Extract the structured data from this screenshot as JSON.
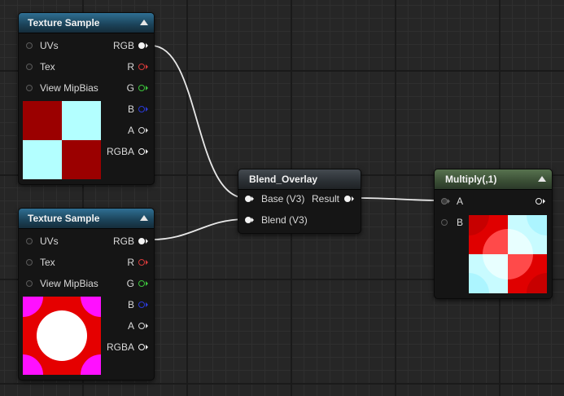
{
  "nodes": {
    "texture_top": {
      "title": "Texture Sample",
      "inputs": [
        "UVs",
        "Tex",
        "View MipBias"
      ],
      "outputs": [
        "RGB",
        "R",
        "G",
        "B",
        "A",
        "RGBA"
      ]
    },
    "texture_bottom": {
      "title": "Texture Sample",
      "inputs": [
        "UVs",
        "Tex",
        "View MipBias"
      ],
      "outputs": [
        "RGB",
        "R",
        "G",
        "B",
        "A",
        "RGBA"
      ]
    },
    "blend": {
      "title": "Blend_Overlay",
      "inputs": [
        "Base (V3)",
        "Blend (V3)"
      ],
      "output": "Result"
    },
    "multiply": {
      "title": "Multiply(,1)",
      "inputs": [
        "A",
        "B"
      ]
    }
  },
  "colors": {
    "pin_white": "#f2f2f2",
    "pin_red": "#d63a3a",
    "pin_green": "#3cc43c",
    "pin_blue": "#2a3ad6",
    "wire": "#e8e8e8",
    "checker_red": "#9b0000",
    "checker_cyan": "#b3ffff",
    "circle_magenta": "#ff10ff",
    "circle_red": "#e50000",
    "circle_white": "#ffffff",
    "mult_red": "#e00000",
    "mult_cyan": "#c8fbff"
  },
  "icons": {
    "collapse": "triangle-up-icon",
    "pin_connected": "filled-circle-arrow-icon",
    "pin_unconnected": "hollow-circle-arrow-icon",
    "pin_input": "empty-circle-icon"
  }
}
